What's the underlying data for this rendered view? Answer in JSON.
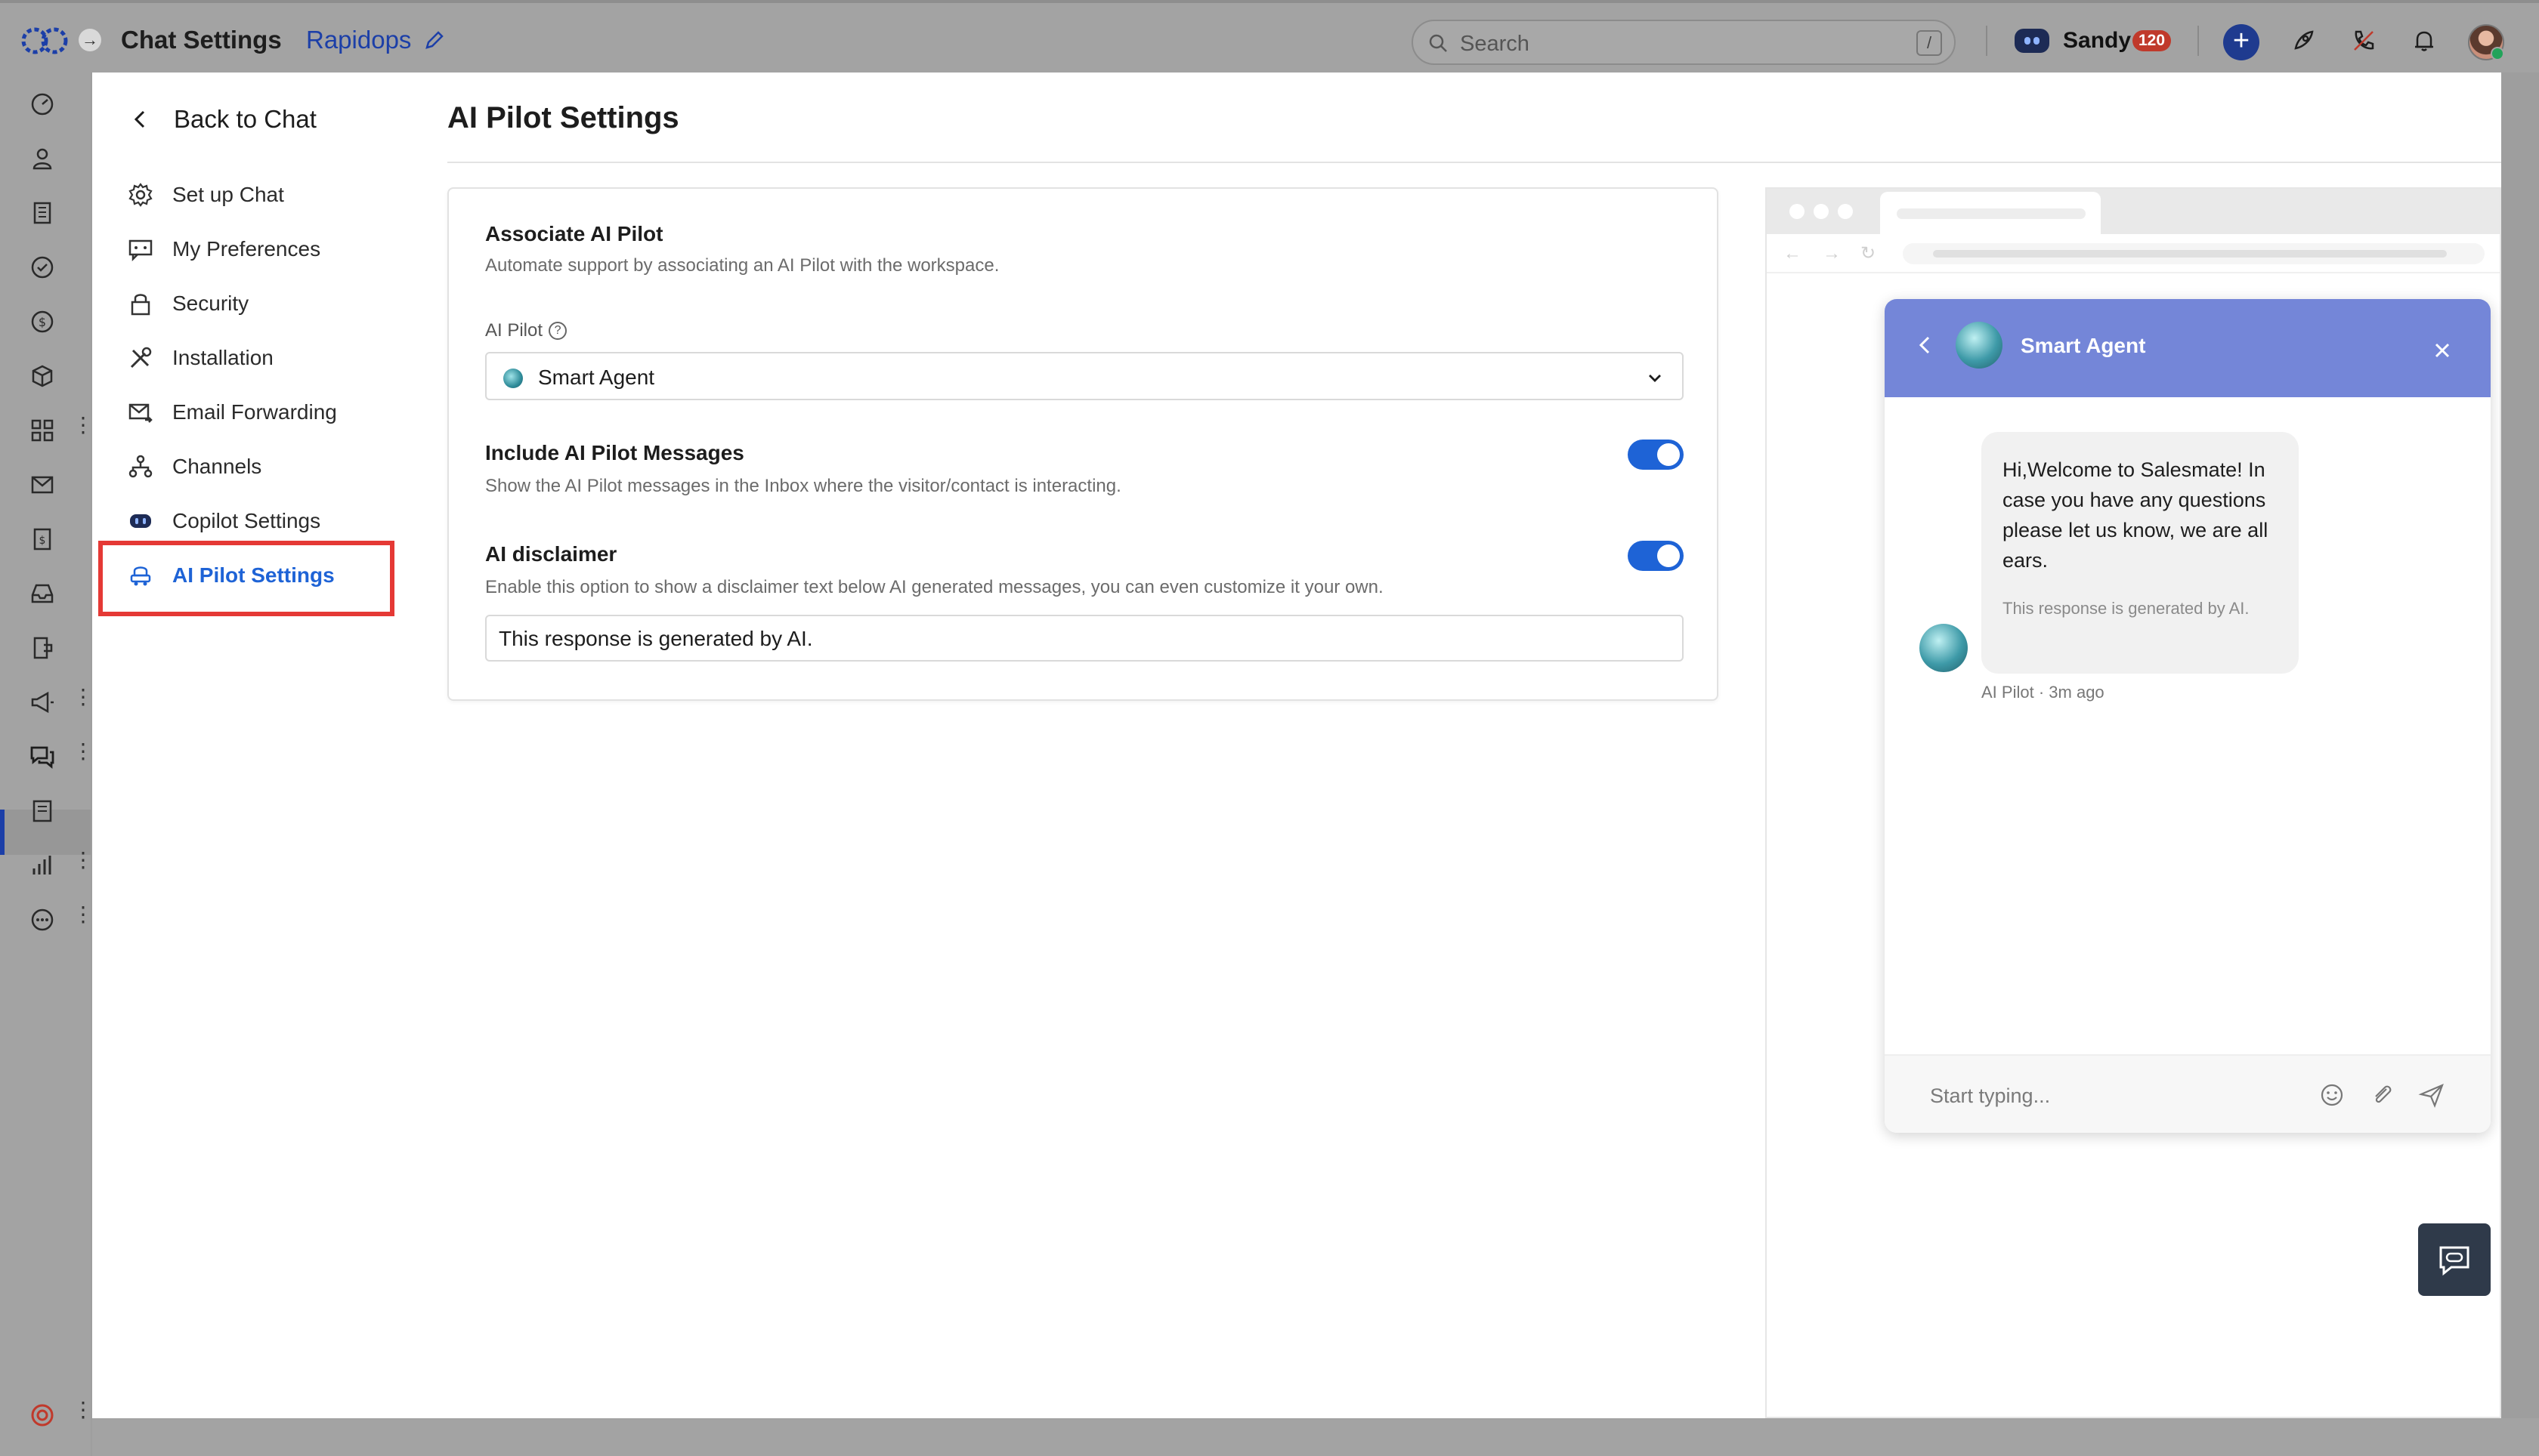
{
  "topbar": {
    "title": "Chat Settings",
    "workspace": "Rapidops",
    "search_placeholder": "Search",
    "search_shortcut": "/",
    "user_name": "Sandy",
    "user_badge": "120",
    "plus_label": "+"
  },
  "rail": {
    "icons": [
      "dashboard-icon",
      "contact-icon",
      "company-icon",
      "task-icon",
      "deal-icon",
      "product-icon",
      "apps-icon",
      "email-icon",
      "invoice-icon",
      "inbox-icon",
      "sequence-icon",
      "campaign-icon",
      "chat-icon",
      "knowledge-icon",
      "report-icon",
      "more-icon",
      "help-icon"
    ],
    "active": "chat-icon"
  },
  "sidebar": {
    "back_label": "Back to Chat",
    "items": [
      {
        "label": "Set up Chat",
        "icon": "gear-icon"
      },
      {
        "label": "My Preferences",
        "icon": "preferences-icon"
      },
      {
        "label": "Security",
        "icon": "lock-icon"
      },
      {
        "label": "Installation",
        "icon": "tools-icon"
      },
      {
        "label": "Email Forwarding",
        "icon": "email-forward-icon"
      },
      {
        "label": "Channels",
        "icon": "channels-icon"
      },
      {
        "label": "Copilot Settings",
        "icon": "copilot-icon"
      },
      {
        "label": "AI Pilot Settings",
        "icon": "ai-pilot-icon"
      }
    ],
    "active_index": 7
  },
  "main": {
    "title": "AI Pilot Settings",
    "associate": {
      "title": "Associate AI Pilot",
      "desc": "Automate support by associating an AI Pilot with the workspace.",
      "field_label": "AI Pilot",
      "selected": "Smart Agent"
    },
    "include": {
      "title": "Include AI Pilot Messages",
      "desc": "Show the AI Pilot messages in the Inbox where the visitor/contact is interacting.",
      "enabled": true
    },
    "disclaimer": {
      "title": "AI disclaimer",
      "desc": "Enable this option to show a disclaimer text below AI generated messages, you can even customize it your own.",
      "enabled": true,
      "value": "This response is generated by AI."
    }
  },
  "preview": {
    "agent_name": "Smart Agent",
    "message": "Hi,Welcome to Salesmate! In case you have any questions please let us know, we are all ears.",
    "disclaimer": "This response is generated by AI.",
    "meta_sender": "AI Pilot",
    "meta_sep": "·",
    "meta_time": "3m ago",
    "input_placeholder": "Start typing...",
    "accent": "#7486d8"
  },
  "colors": {
    "primary": "#1e63d6",
    "highlight_border": "#e53935"
  }
}
